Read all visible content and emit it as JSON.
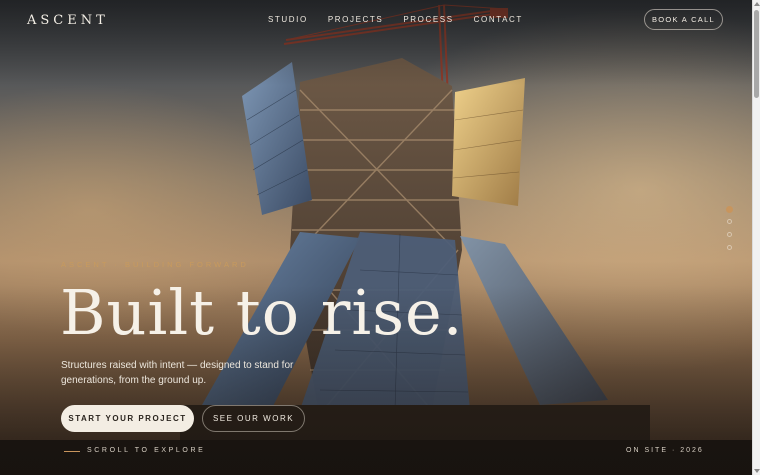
{
  "brand": {
    "logo": "ASCENT"
  },
  "nav": {
    "items": [
      "STUDIO",
      "PROJECTS",
      "PROCESS",
      "CONTACT"
    ]
  },
  "header": {
    "cta_label": "BOOK A CALL"
  },
  "hero": {
    "eyebrow": "ASCENT · BUILDING FORWARD",
    "headline": "Built to rise.",
    "lede": "Structures raised with intent — designed to stand for generations, from the ground up.",
    "primary_label": "START YOUR PROJECT",
    "secondary_label": "SEE OUR WORK",
    "scroll_hint": "SCROLL TO EXPLORE",
    "status": "ON SITE · 2026"
  },
  "slides": {
    "count": 4,
    "active_index": 0
  },
  "colors": {
    "accent": "#c8955d",
    "text_light": "#f6f1e8",
    "button_bg": "#f3ede3"
  },
  "icons": [
    "scroll-line-icon",
    "slide-indicator-dot"
  ]
}
